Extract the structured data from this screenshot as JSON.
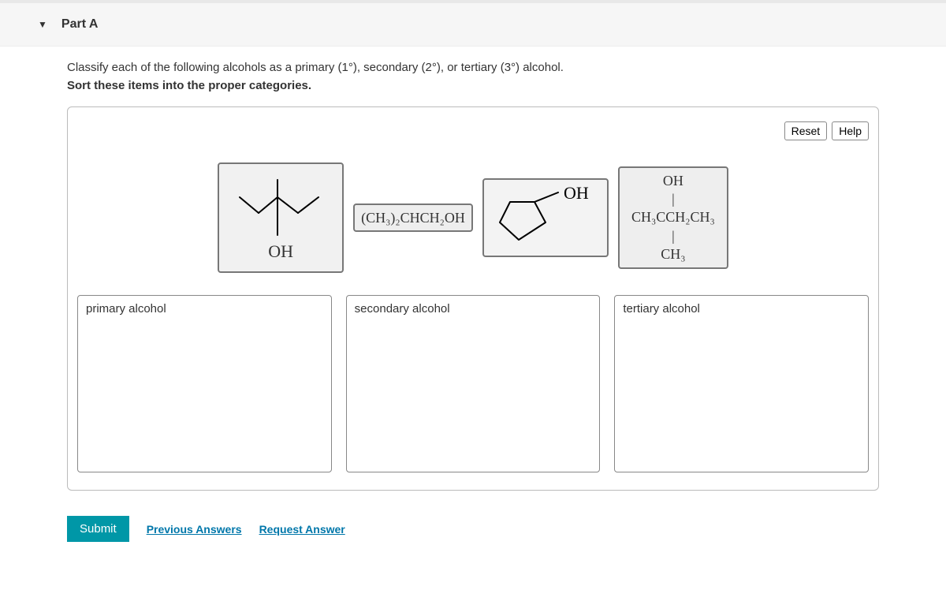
{
  "part": {
    "label": "Part A"
  },
  "instruction_line1": "Classify each of the following alcohols as a primary (1°), secondary (2°), or tertiary (3°) alcohol.",
  "instruction_line2": "Sort these items into the proper categories.",
  "controls": {
    "reset": "Reset",
    "help": "Help"
  },
  "items": {
    "structure1_oh": "OH",
    "formula1_html": "(CH₃)₂CHCH₂OH",
    "structure2_oh": "OH",
    "formula2_line1": "OH",
    "formula2_line2": "|",
    "formula2_line3_html": "CH₃CCH₂CH₃",
    "formula2_line4": "|",
    "formula2_line5_html": "CH₃"
  },
  "bins": {
    "primary": "primary alcohol",
    "secondary": "secondary alcohol",
    "tertiary": "tertiary alcohol"
  },
  "actions": {
    "submit": "Submit",
    "previous": "Previous Answers",
    "request": "Request Answer"
  }
}
